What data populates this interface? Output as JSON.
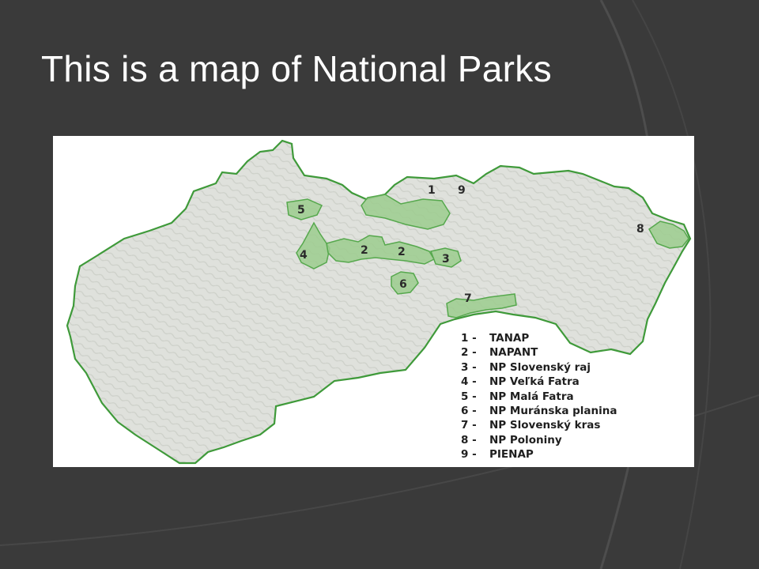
{
  "slide": {
    "title": "This is a map of National Parks",
    "colors": {
      "background": "#3a3a3a",
      "arc": "#4d4d4d",
      "title": "#ffffff"
    }
  },
  "map": {
    "colors": {
      "border": "#3f9a3a",
      "land": "#dfe1dc",
      "park_fill": "#9ccc8e",
      "park_stroke": "#56a84d"
    },
    "parks": [
      {
        "number": "1",
        "label": "1",
        "legend": "1 -",
        "name": "TANAP"
      },
      {
        "number": "2",
        "label": "2",
        "legend": "2 -",
        "name": "NAPANT"
      },
      {
        "number": "2",
        "label": "2"
      },
      {
        "number": "3",
        "label": "3",
        "legend": "3 -",
        "name": "NP Slovenský raj"
      },
      {
        "number": "4",
        "label": "4",
        "legend": "4 -",
        "name": "NP Veľká Fatra"
      },
      {
        "number": "5",
        "label": "5",
        "legend": "5 -",
        "name": "NP Malá Fatra"
      },
      {
        "number": "6",
        "label": "6",
        "legend": "6 -",
        "name": "NP Muránska planina"
      },
      {
        "number": "7",
        "label": "7",
        "legend": "7 -",
        "name": "NP Slovenský kras"
      },
      {
        "number": "8",
        "label": "8",
        "legend": "8 -",
        "name": "NP Poloniny"
      },
      {
        "number": "9",
        "label": "9",
        "legend": "9 -",
        "name": "PIENAP"
      }
    ]
  }
}
